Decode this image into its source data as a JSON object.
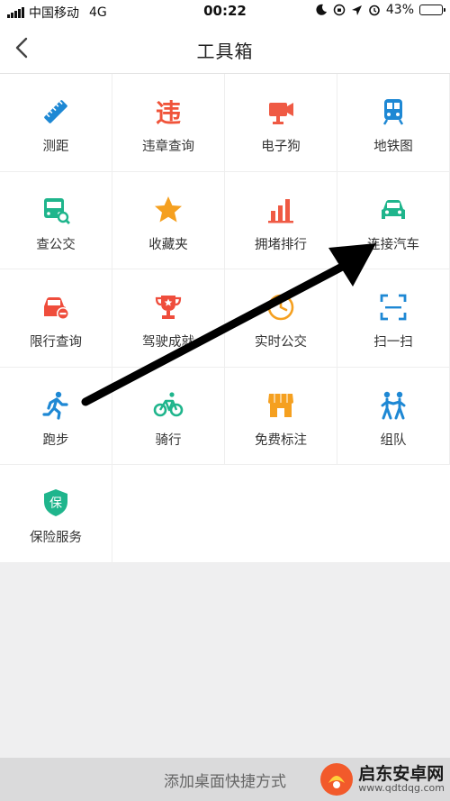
{
  "status_bar": {
    "carrier": "中国移动",
    "network": "4G",
    "time": "00:22",
    "battery": "43%",
    "battery_level": 0.43
  },
  "nav": {
    "title": "工具箱"
  },
  "tools": [
    {
      "label": "测距",
      "icon": "ruler-icon",
      "color": "#1e88d4"
    },
    {
      "label": "违章查询",
      "icon": "violation-icon",
      "color": "#f0543a"
    },
    {
      "label": "电子狗",
      "icon": "camera-icon",
      "color": "#ef5a44"
    },
    {
      "label": "地铁图",
      "icon": "subway-icon",
      "color": "#1e88d4"
    },
    {
      "label": "查公交",
      "icon": "bus-search-icon",
      "color": "#1fb58c"
    },
    {
      "label": "收藏夹",
      "icon": "star-icon",
      "color": "#f5a020"
    },
    {
      "label": "拥堵排行",
      "icon": "bar-chart-icon",
      "color": "#ef5a44"
    },
    {
      "label": "连接汽车",
      "icon": "car-icon",
      "color": "#1fb58c"
    },
    {
      "label": "限行查询",
      "icon": "restricted-car-icon",
      "color": "#ef4d3c"
    },
    {
      "label": "驾驶成就",
      "icon": "trophy-icon",
      "color": "#ef4d3c"
    },
    {
      "label": "实时公交",
      "icon": "clock-icon",
      "color": "#f5a020"
    },
    {
      "label": "扫一扫",
      "icon": "scan-icon",
      "color": "#1e88d4"
    },
    {
      "label": "跑步",
      "icon": "runner-icon",
      "color": "#1e88d4"
    },
    {
      "label": "骑行",
      "icon": "bicycle-icon",
      "color": "#1fb58c"
    },
    {
      "label": "免费标注",
      "icon": "shop-icon",
      "color": "#f5a020"
    },
    {
      "label": "组队",
      "icon": "team-icon",
      "color": "#1e88d4"
    },
    {
      "label": "保险服务",
      "icon": "insurance-shield-icon",
      "color": "#1fb58c",
      "glyph": "保"
    }
  ],
  "bottom": {
    "label": "添加桌面快捷方式"
  },
  "watermark": {
    "title": "启东安卓网",
    "url": "www.qdtdqg.com"
  }
}
